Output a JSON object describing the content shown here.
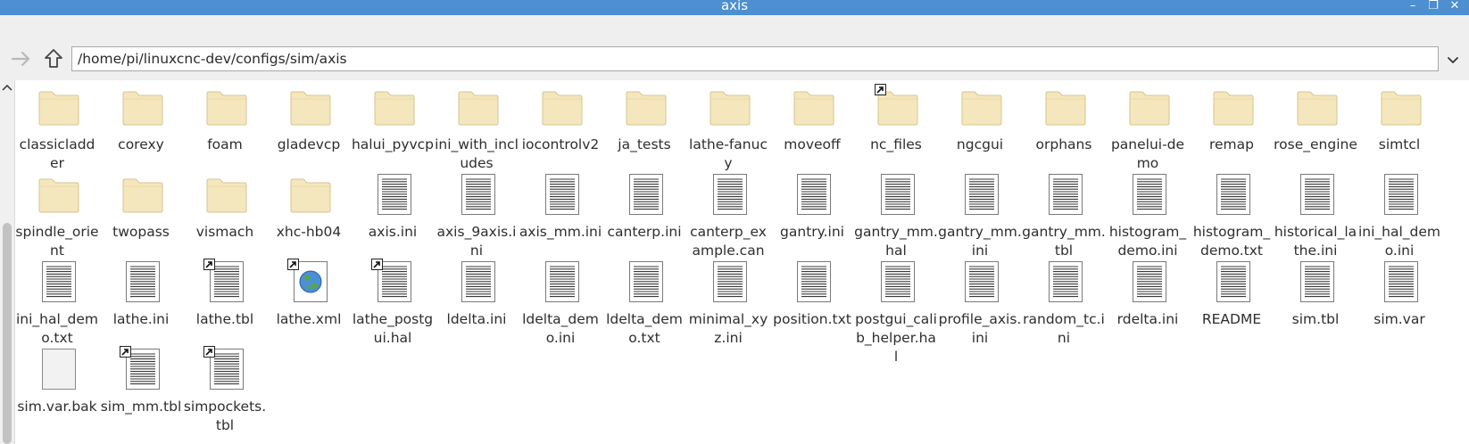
{
  "window": {
    "title": "axis",
    "minimize_label": "–",
    "maximize_label": "❐",
    "close_label": "✕"
  },
  "toolbar": {
    "path": "/home/pi/linuxcnc-dev/configs/sim/axis"
  },
  "colors": {
    "titlebar": "#4d8fd1",
    "folder_fill": "#f5e7bd",
    "folder_stroke": "#d6c48e",
    "toolbar_bg": "#efefef"
  },
  "files": [
    {
      "name": "classicladder",
      "type": "folder",
      "link": false
    },
    {
      "name": "corexy",
      "type": "folder",
      "link": false
    },
    {
      "name": "foam",
      "type": "folder",
      "link": false
    },
    {
      "name": "gladevcp",
      "type": "folder",
      "link": false
    },
    {
      "name": "halui_pyvcp",
      "type": "folder",
      "link": false
    },
    {
      "name": "ini_with_includes",
      "type": "folder",
      "link": false
    },
    {
      "name": "iocontrolv2",
      "type": "folder",
      "link": false
    },
    {
      "name": "ja_tests",
      "type": "folder",
      "link": false
    },
    {
      "name": "lathe-fanucy",
      "type": "folder",
      "link": false
    },
    {
      "name": "moveoff",
      "type": "folder",
      "link": false
    },
    {
      "name": "nc_files",
      "type": "folder",
      "link": true
    },
    {
      "name": "ngcgui",
      "type": "folder",
      "link": false
    },
    {
      "name": "orphans",
      "type": "folder",
      "link": false
    },
    {
      "name": "panelui-demo",
      "type": "folder",
      "link": false
    },
    {
      "name": "remap",
      "type": "folder",
      "link": false
    },
    {
      "name": "rose_engine",
      "type": "folder",
      "link": false
    },
    {
      "name": "simtcl",
      "type": "folder",
      "link": false
    },
    {
      "name": "spindle_orient",
      "type": "folder",
      "link": false
    },
    {
      "name": "twopass",
      "type": "folder",
      "link": false
    },
    {
      "name": "vismach",
      "type": "folder",
      "link": false
    },
    {
      "name": "xhc-hb04",
      "type": "folder",
      "link": false
    },
    {
      "name": "axis.ini",
      "type": "text",
      "link": false
    },
    {
      "name": "axis_9axis.ini",
      "type": "text",
      "link": false
    },
    {
      "name": "axis_mm.ini",
      "type": "text",
      "link": false
    },
    {
      "name": "canterp.ini",
      "type": "text",
      "link": false
    },
    {
      "name": "canterp_example.can",
      "type": "text",
      "link": false
    },
    {
      "name": "gantry.ini",
      "type": "text",
      "link": false
    },
    {
      "name": "gantry_mm.hal",
      "type": "text",
      "link": false
    },
    {
      "name": "gantry_mm.ini",
      "type": "text",
      "link": false
    },
    {
      "name": "gantry_mm.tbl",
      "type": "text",
      "link": false
    },
    {
      "name": "histogram_demo.ini",
      "type": "text",
      "link": false
    },
    {
      "name": "histogram_demo.txt",
      "type": "text",
      "link": false
    },
    {
      "name": "historical_lathe.ini",
      "type": "text",
      "link": false
    },
    {
      "name": "ini_hal_demo.ini",
      "type": "text",
      "link": false
    },
    {
      "name": "ini_hal_demo.txt",
      "type": "text",
      "link": false
    },
    {
      "name": "lathe.ini",
      "type": "text",
      "link": false
    },
    {
      "name": "lathe.tbl",
      "type": "text",
      "link": true
    },
    {
      "name": "lathe.xml",
      "type": "xml",
      "link": true
    },
    {
      "name": "lathe_postgui.hal",
      "type": "text",
      "link": true
    },
    {
      "name": "ldelta.ini",
      "type": "text",
      "link": false
    },
    {
      "name": "ldelta_demo.ini",
      "type": "text",
      "link": false
    },
    {
      "name": "ldelta_demo.txt",
      "type": "text",
      "link": false
    },
    {
      "name": "minimal_xyz.ini",
      "type": "text",
      "link": false
    },
    {
      "name": "position.txt",
      "type": "text",
      "link": false
    },
    {
      "name": "postgui_calib_helper.hal",
      "type": "text",
      "link": false
    },
    {
      "name": "profile_axis.ini",
      "type": "text",
      "link": false
    },
    {
      "name": "random_tc.ini",
      "type": "text",
      "link": false
    },
    {
      "name": "rdelta.ini",
      "type": "text",
      "link": false
    },
    {
      "name": "README",
      "type": "text",
      "link": false
    },
    {
      "name": "sim.tbl",
      "type": "text",
      "link": false
    },
    {
      "name": "sim.var",
      "type": "text",
      "link": false
    },
    {
      "name": "sim.var.bak",
      "type": "blank",
      "link": false
    },
    {
      "name": "sim_mm.tbl",
      "type": "text",
      "link": true
    },
    {
      "name": "simpockets.tbl",
      "type": "text",
      "link": true
    }
  ]
}
